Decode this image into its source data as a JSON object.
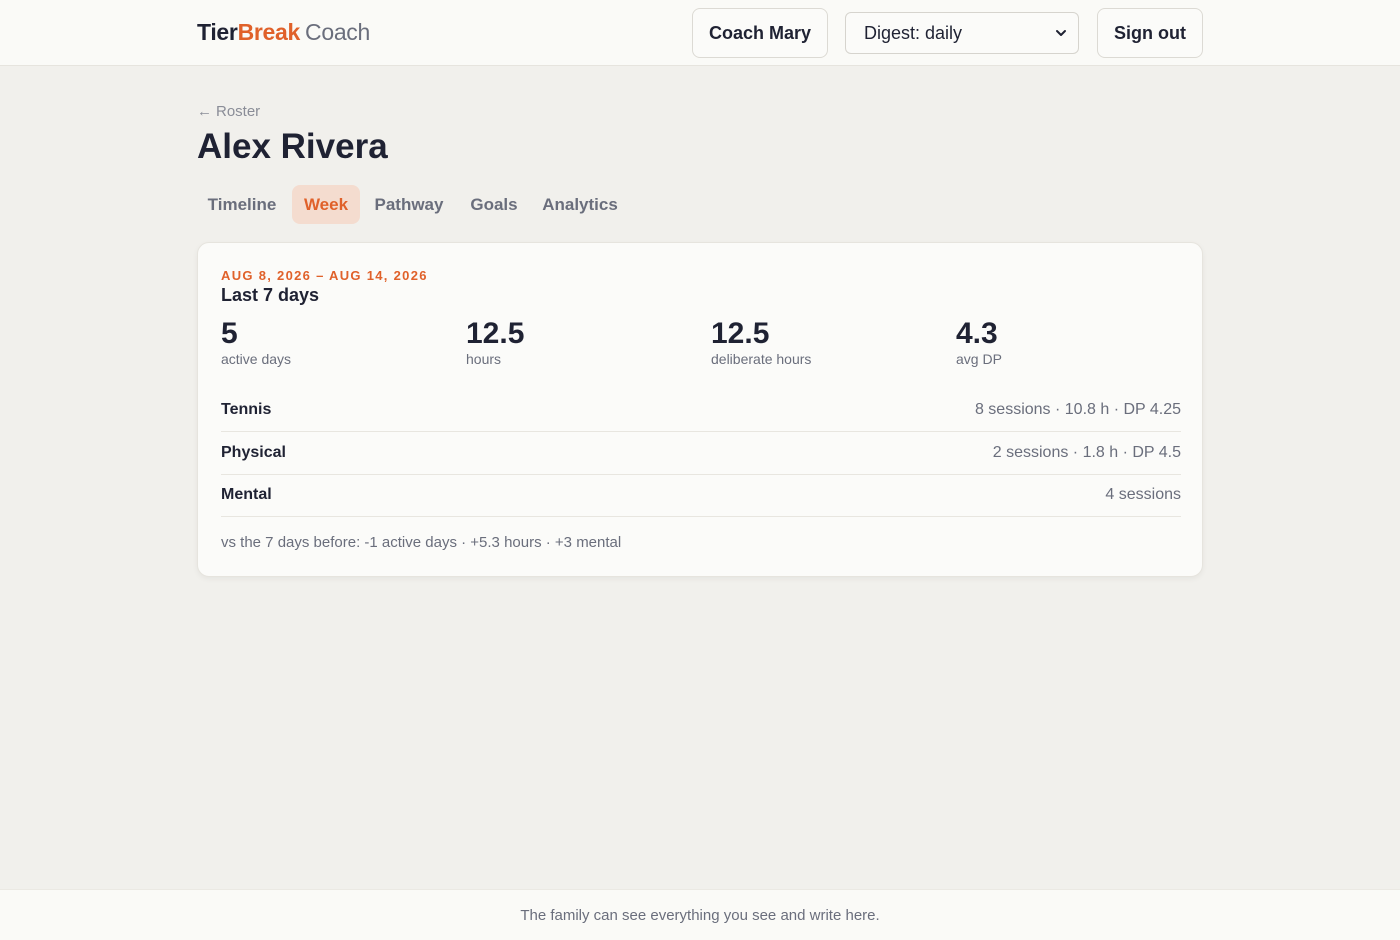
{
  "brand": {
    "part1": "Tier",
    "part2": "Break",
    "part3": "Coach"
  },
  "header": {
    "coach_label": "Coach Mary",
    "digest_value": "Digest: daily",
    "signout_label": "Sign out"
  },
  "breadcrumb": {
    "arrow": "←",
    "label": "Roster"
  },
  "athlete_name": "Alex Rivera",
  "tabs": [
    {
      "label": "Timeline",
      "active": false
    },
    {
      "label": "Week",
      "active": true
    },
    {
      "label": "Pathway",
      "active": false
    },
    {
      "label": "Goals",
      "active": false
    },
    {
      "label": "Analytics",
      "active": false
    }
  ],
  "week": {
    "range": "AUG 8, 2026 – AUG 14, 2026",
    "title": "Last 7 days",
    "stats": [
      {
        "value": "5",
        "label": "active days"
      },
      {
        "value": "12.5",
        "label": "hours"
      },
      {
        "value": "12.5",
        "label": "deliberate hours"
      },
      {
        "value": "4.3",
        "label": "avg DP"
      }
    ],
    "categories": [
      {
        "name": "Tennis",
        "summary": "8 sessions · 10.8 h · DP 4.25"
      },
      {
        "name": "Physical",
        "summary": "2 sessions · 1.8 h · DP 4.5"
      },
      {
        "name": "Mental",
        "summary": "4 sessions"
      }
    ],
    "comparison": "vs the 7 days before: -1 active days · +5.3 hours · +3 mental"
  },
  "footer_text": "The family can see everything you see and write here.",
  "colors": {
    "accent": "#e0612a",
    "text": "#1f2233",
    "muted": "#6a6e7c",
    "background": "#f1f0ec"
  }
}
